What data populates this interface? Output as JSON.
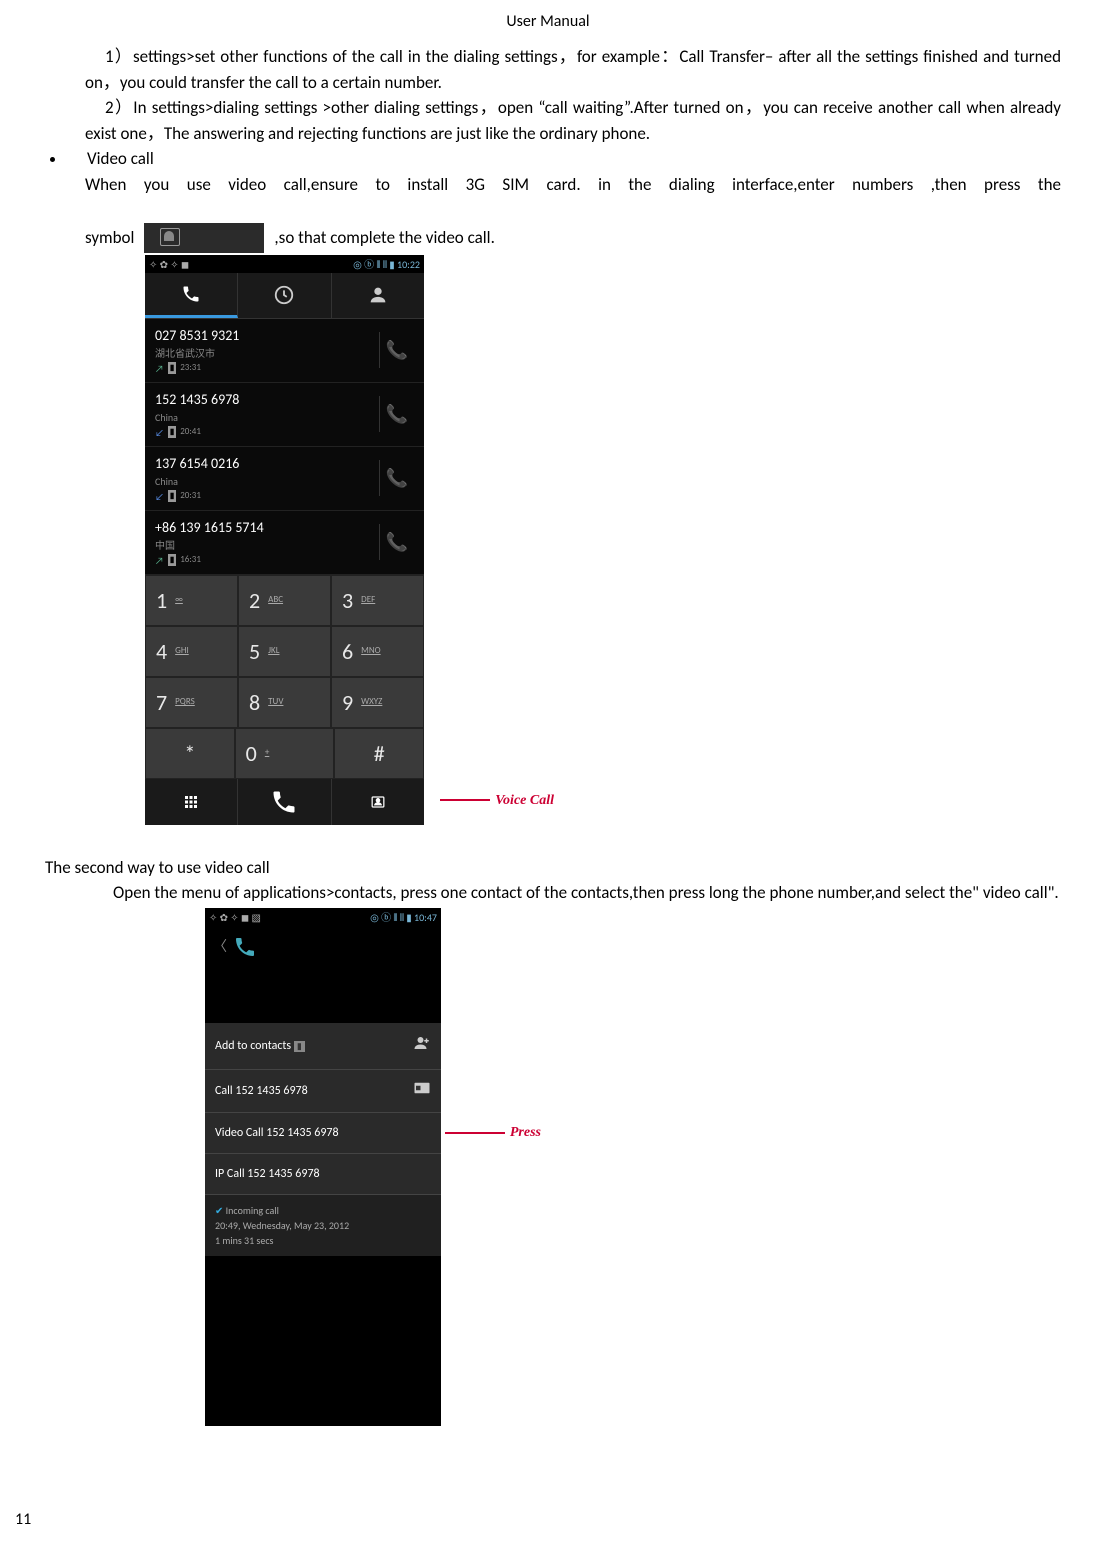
{
  "header": "User    Manual",
  "body": {
    "para1": "1）settings>set other functions of the call in the dialing settings，for example：Call Transfer– after all the settings finished and turned on，you could transfer the call to a certain number.",
    "para2": "2）In settings>dialing settings >other dialing settings，open “call waiting”.After turned on，you can receive another call when already exist one，The answering and rejecting functions are just like the ordinary phone.",
    "videocall_heading": "Video call",
    "videocall_line1": "When you use video call,ensure to install 3G SIM card. in the dialing interface,enter numbers ,then press the",
    "videocall_line2_a": "symbol",
    "videocall_line2_b": ",so that complete the video call.",
    "section2_heading": "The second way to use video call",
    "section2_para": "Open the menu of applications>contacts, press  one contact of the contacts,then press long the phone number,and select the\" video call\"."
  },
  "screenshot1": {
    "statusbar_time": "10:22",
    "annotation": "Voice Call",
    "entries": [
      {
        "number": "027 8531 9321",
        "location": "湖北省武汉市",
        "dir": "out",
        "time": "23:31"
      },
      {
        "number": "152 1435 6978",
        "location": "China",
        "dir": "in",
        "time": "20:41"
      },
      {
        "number": "137 6154 0216",
        "location": "China",
        "dir": "in",
        "time": "20:31"
      },
      {
        "number": "+86 139 1615 5714",
        "location": "中国",
        "dir": "out",
        "time": "16:31"
      }
    ],
    "keypad": [
      [
        {
          "n": "1",
          "l": "∞"
        },
        {
          "n": "2",
          "l": "ABC"
        },
        {
          "n": "3",
          "l": "DEF"
        }
      ],
      [
        {
          "n": "4",
          "l": "GHI"
        },
        {
          "n": "5",
          "l": "JKL"
        },
        {
          "n": "6",
          "l": "MNO"
        }
      ],
      [
        {
          "n": "7",
          "l": "PQRS"
        },
        {
          "n": "8",
          "l": "TUV"
        },
        {
          "n": "9",
          "l": "WXYZ"
        }
      ],
      [
        {
          "n": "*",
          "l": ""
        },
        {
          "n": "0",
          "l": "+"
        },
        {
          "n": "#",
          "l": ""
        }
      ]
    ]
  },
  "screenshot2": {
    "statusbar_time": "10:47",
    "annotation": "Press",
    "menu": {
      "add": "Add to contacts",
      "call": "Call 152 1435 6978",
      "video": "Video Call 152 1435 6978",
      "ip": "IP Call 152 1435 6978"
    },
    "incoming": {
      "label": "Incoming call",
      "timestamp": "20:49, Wednesday, May 23, 2012",
      "duration": "1 mins 31 secs"
    }
  },
  "page_number": "11"
}
